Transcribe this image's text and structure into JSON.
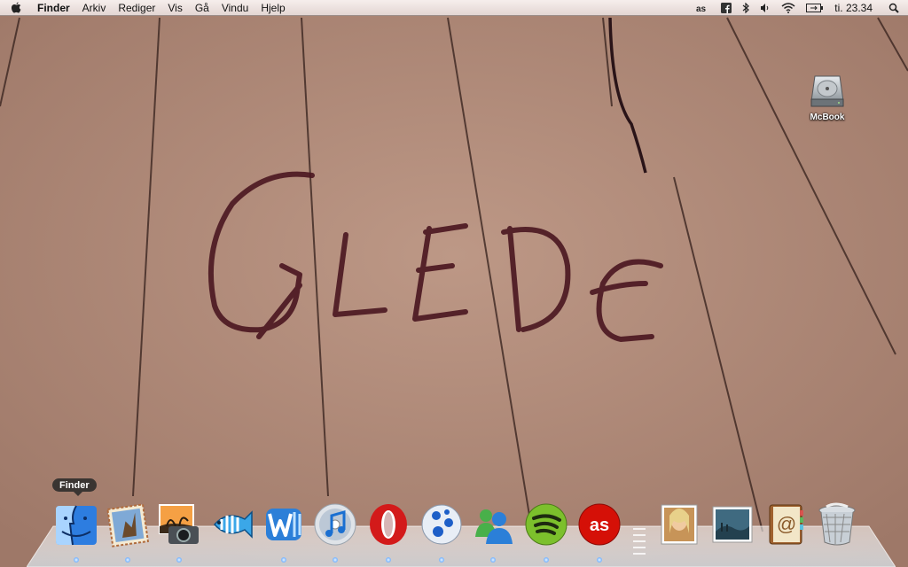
{
  "menubar": {
    "app_name": "Finder",
    "menus": [
      "Arkiv",
      "Rediger",
      "Vis",
      "Gå",
      "Vindu",
      "Hjelp"
    ],
    "clock": "ti. 23.34",
    "status_icons": [
      "lastfm-icon",
      "facebook-icon",
      "bluetooth-icon",
      "volume-icon",
      "wifi-icon",
      "battery-icon",
      "spotlight-icon"
    ]
  },
  "wallpaper": {
    "handwritten_text": "GLEDE",
    "paper_color": "#b08a78",
    "ink_color": "#4a1620"
  },
  "desktop": {
    "icons": [
      {
        "label": "McBook",
        "icon": "hard-drive-icon"
      }
    ]
  },
  "dock": {
    "tooltip": "Finder",
    "apps": [
      {
        "name": "Finder",
        "icon": "finder-icon",
        "running": true
      },
      {
        "name": "Mail",
        "icon": "mail-icon",
        "running": true
      },
      {
        "name": "iPhoto",
        "icon": "iphoto-icon",
        "running": true
      },
      {
        "name": "Fish",
        "icon": "fish-icon",
        "running": false
      },
      {
        "name": "Word",
        "icon": "word-icon",
        "running": true
      },
      {
        "name": "iTunes",
        "icon": "itunes-icon",
        "running": true
      },
      {
        "name": "Opera",
        "icon": "opera-icon",
        "running": true
      },
      {
        "name": "Adium",
        "icon": "adium-icon",
        "running": true
      },
      {
        "name": "Messenger",
        "icon": "messenger-icon",
        "running": true
      },
      {
        "name": "Spotify",
        "icon": "spotify-icon",
        "running": true
      },
      {
        "name": "Last.fm",
        "icon": "lastfm-dock-icon",
        "running": true
      }
    ],
    "stacks": [
      {
        "name": "Pictures",
        "icon": "photo-stack-icon"
      },
      {
        "name": "Downloads",
        "icon": "landscape-stack-icon"
      },
      {
        "name": "Address Book",
        "icon": "address-book-icon"
      },
      {
        "name": "Trash",
        "icon": "trash-icon"
      }
    ]
  }
}
